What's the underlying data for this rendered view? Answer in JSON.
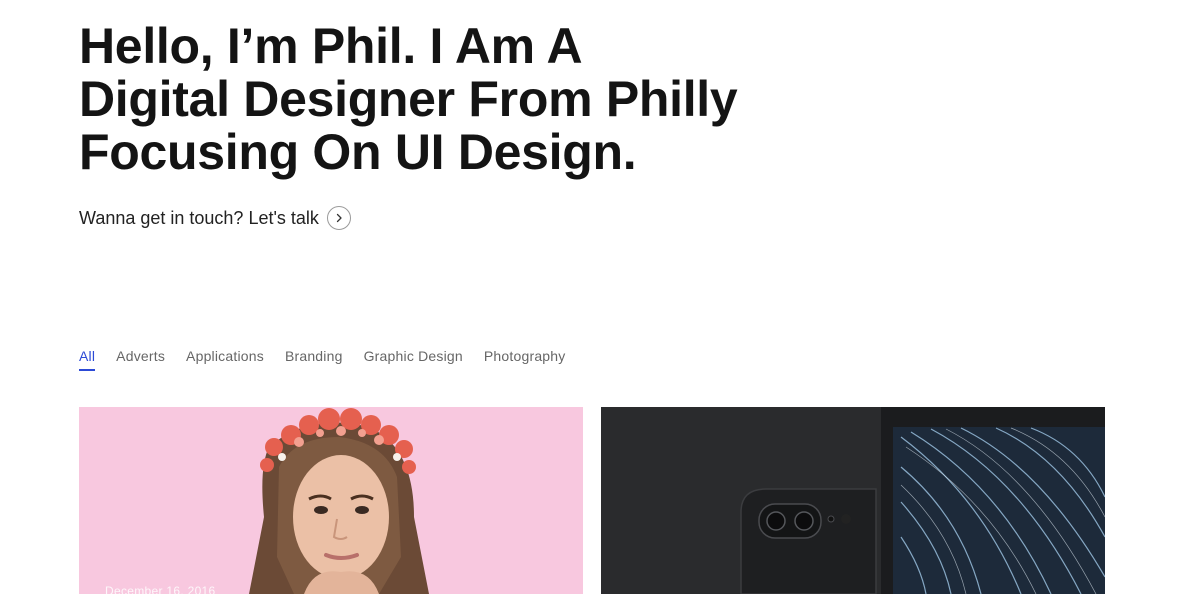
{
  "hero": {
    "line1": "Hello, I’m Phil. I Am A",
    "line2": "Digital Designer From Philly",
    "line3": "Focusing On UI Design."
  },
  "cta": {
    "label": "Wanna get in touch? Let's talk",
    "icon": "chevron-right-icon"
  },
  "filters": {
    "active": "All",
    "items": [
      "All",
      "Adverts",
      "Applications",
      "Branding",
      "Graphic Design",
      "Photography"
    ]
  },
  "portfolio": {
    "cards": [
      {
        "date": "December 16, 2016",
        "image": "woman-flower-crown-photo"
      },
      {
        "image": "phone-and-laptop-light-trails-photo"
      }
    ]
  },
  "colors": {
    "accent": "#2c4ad6",
    "card1_bg": "#f8c8df",
    "card2_bg": "#2a2b2d"
  }
}
